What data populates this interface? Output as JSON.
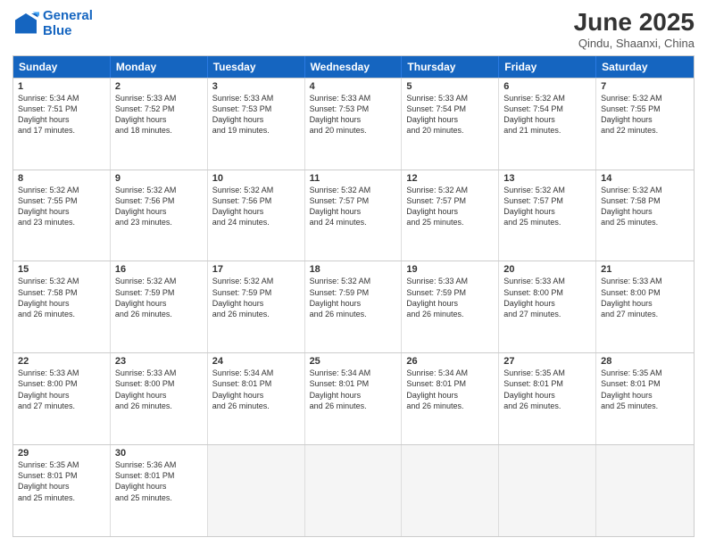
{
  "header": {
    "logo_line1": "General",
    "logo_line2": "Blue",
    "main_title": "June 2025",
    "subtitle": "Qindu, Shaanxi, China"
  },
  "calendar": {
    "days_of_week": [
      "Sunday",
      "Monday",
      "Tuesday",
      "Wednesday",
      "Thursday",
      "Friday",
      "Saturday"
    ],
    "weeks": [
      [
        {
          "day": "",
          "empty": true
        },
        {
          "day": "2",
          "sunrise": "5:33 AM",
          "sunset": "7:52 PM",
          "daylight": "14 hours and 18 minutes."
        },
        {
          "day": "3",
          "sunrise": "5:33 AM",
          "sunset": "7:53 PM",
          "daylight": "14 hours and 19 minutes."
        },
        {
          "day": "4",
          "sunrise": "5:33 AM",
          "sunset": "7:53 PM",
          "daylight": "14 hours and 20 minutes."
        },
        {
          "day": "5",
          "sunrise": "5:33 AM",
          "sunset": "7:54 PM",
          "daylight": "14 hours and 20 minutes."
        },
        {
          "day": "6",
          "sunrise": "5:32 AM",
          "sunset": "7:54 PM",
          "daylight": "14 hours and 21 minutes."
        },
        {
          "day": "7",
          "sunrise": "5:32 AM",
          "sunset": "7:55 PM",
          "daylight": "14 hours and 22 minutes."
        }
      ],
      [
        {
          "day": "1",
          "sunrise": "5:34 AM",
          "sunset": "7:51 PM",
          "daylight": "14 hours and 17 minutes."
        },
        {
          "day": "9",
          "sunrise": "5:32 AM",
          "sunset": "7:56 PM",
          "daylight": "14 hours and 23 minutes."
        },
        {
          "day": "10",
          "sunrise": "5:32 AM",
          "sunset": "7:56 PM",
          "daylight": "14 hours and 24 minutes."
        },
        {
          "day": "11",
          "sunrise": "5:32 AM",
          "sunset": "7:57 PM",
          "daylight": "14 hours and 24 minutes."
        },
        {
          "day": "12",
          "sunrise": "5:32 AM",
          "sunset": "7:57 PM",
          "daylight": "14 hours and 25 minutes."
        },
        {
          "day": "13",
          "sunrise": "5:32 AM",
          "sunset": "7:57 PM",
          "daylight": "14 hours and 25 minutes."
        },
        {
          "day": "14",
          "sunrise": "5:32 AM",
          "sunset": "7:58 PM",
          "daylight": "14 hours and 25 minutes."
        }
      ],
      [
        {
          "day": "8",
          "sunrise": "5:32 AM",
          "sunset": "7:55 PM",
          "daylight": "14 hours and 23 minutes."
        },
        {
          "day": "16",
          "sunrise": "5:32 AM",
          "sunset": "7:59 PM",
          "daylight": "14 hours and 26 minutes."
        },
        {
          "day": "17",
          "sunrise": "5:32 AM",
          "sunset": "7:59 PM",
          "daylight": "14 hours and 26 minutes."
        },
        {
          "day": "18",
          "sunrise": "5:32 AM",
          "sunset": "7:59 PM",
          "daylight": "14 hours and 26 minutes."
        },
        {
          "day": "19",
          "sunrise": "5:33 AM",
          "sunset": "7:59 PM",
          "daylight": "14 hours and 26 minutes."
        },
        {
          "day": "20",
          "sunrise": "5:33 AM",
          "sunset": "8:00 PM",
          "daylight": "14 hours and 27 minutes."
        },
        {
          "day": "21",
          "sunrise": "5:33 AM",
          "sunset": "8:00 PM",
          "daylight": "14 hours and 27 minutes."
        }
      ],
      [
        {
          "day": "15",
          "sunrise": "5:32 AM",
          "sunset": "7:58 PM",
          "daylight": "14 hours and 26 minutes."
        },
        {
          "day": "23",
          "sunrise": "5:33 AM",
          "sunset": "8:00 PM",
          "daylight": "14 hours and 26 minutes."
        },
        {
          "day": "24",
          "sunrise": "5:34 AM",
          "sunset": "8:01 PM",
          "daylight": "14 hours and 26 minutes."
        },
        {
          "day": "25",
          "sunrise": "5:34 AM",
          "sunset": "8:01 PM",
          "daylight": "14 hours and 26 minutes."
        },
        {
          "day": "26",
          "sunrise": "5:34 AM",
          "sunset": "8:01 PM",
          "daylight": "14 hours and 26 minutes."
        },
        {
          "day": "27",
          "sunrise": "5:35 AM",
          "sunset": "8:01 PM",
          "daylight": "14 hours and 26 minutes."
        },
        {
          "day": "28",
          "sunrise": "5:35 AM",
          "sunset": "8:01 PM",
          "daylight": "14 hours and 25 minutes."
        }
      ],
      [
        {
          "day": "22",
          "sunrise": "5:33 AM",
          "sunset": "8:00 PM",
          "daylight": "14 hours and 27 minutes."
        },
        {
          "day": "30",
          "sunrise": "5:36 AM",
          "sunset": "8:01 PM",
          "daylight": "14 hours and 25 minutes."
        },
        {
          "day": "",
          "empty": true
        },
        {
          "day": "",
          "empty": true
        },
        {
          "day": "",
          "empty": true
        },
        {
          "day": "",
          "empty": true
        },
        {
          "day": "",
          "empty": true
        }
      ],
      [
        {
          "day": "29",
          "sunrise": "5:35 AM",
          "sunset": "8:01 PM",
          "daylight": "14 hours and 25 minutes."
        },
        {
          "day": "",
          "empty": true
        },
        {
          "day": "",
          "empty": true
        },
        {
          "day": "",
          "empty": true
        },
        {
          "day": "",
          "empty": true
        },
        {
          "day": "",
          "empty": true
        },
        {
          "day": "",
          "empty": true
        }
      ]
    ]
  }
}
